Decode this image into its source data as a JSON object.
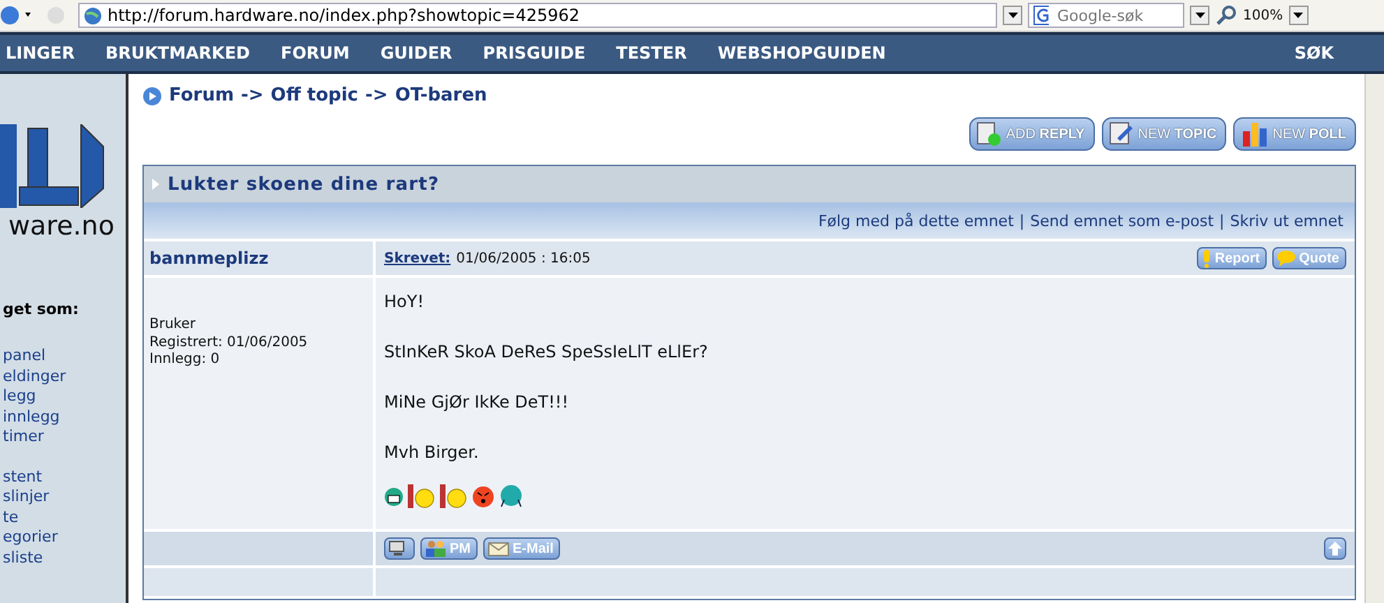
{
  "browser": {
    "address": "http://forum.hardware.no/index.php?showtopic=425962",
    "search": {
      "placeholder": "Google-søk"
    },
    "zoom": "100%"
  },
  "nav": {
    "items": [
      "LINGER",
      "BRUKTMARKED",
      "FORUM",
      "GUIDER",
      "PRISGUIDE",
      "TESTER",
      "WEBSHOPGUIDEN"
    ],
    "search": "SØK"
  },
  "sidebar": {
    "logo_text": "ware.no",
    "heading": "get som:",
    "groups": [
      [
        "panel",
        "eldinger",
        "legg",
        "innlegg",
        "timer"
      ],
      [
        "stent",
        "slinjer",
        "te",
        "egorier",
        "sliste"
      ]
    ]
  },
  "breadcrumb": [
    "Forum",
    "->",
    "Off topic",
    "->",
    "OT-baren"
  ],
  "actions": [
    {
      "label": "ADD **REPLY**",
      "kind": "reply"
    },
    {
      "label": "NEW **TOPIC**",
      "kind": "topic"
    },
    {
      "label": "NEW **POLL**",
      "kind": "poll"
    }
  ],
  "topic": {
    "title": "Lukter skoene dine rart?",
    "links": [
      "Følg med på dette emnet",
      "|",
      "Send emnet som e-post",
      "|",
      "Skriv ut emnet"
    ],
    "post": {
      "author": "bannmeplizz",
      "posted_label": "Skrevet:",
      "posted": "01/06/2005 : 16:05",
      "tools": [
        {
          "label": "Report",
          "kind": "report"
        },
        {
          "label": "Quote",
          "kind": "quote"
        }
      ],
      "info": [
        "Bruker",
        "Registrert: 01/06/2005",
        "Innlegg: 0"
      ],
      "lines": [
        "HoY!",
        "StInKeR SkoA DeReS SpeSsIeLlT eLlEr?",
        "MiNe GjØr IkKe DeT!!!",
        "Mvh Birger."
      ],
      "emoticons": [
        {
          "kind": "grin"
        },
        {
          "kind": "bang"
        },
        {
          "kind": "bang"
        },
        {
          "kind": "angry"
        },
        {
          "kind": "sad"
        }
      ],
      "contacts": [
        {
          "kind": "profile"
        },
        {
          "kind": "pm",
          "label": "PM"
        },
        {
          "kind": "email",
          "label": "E-Mail"
        }
      ]
    }
  }
}
